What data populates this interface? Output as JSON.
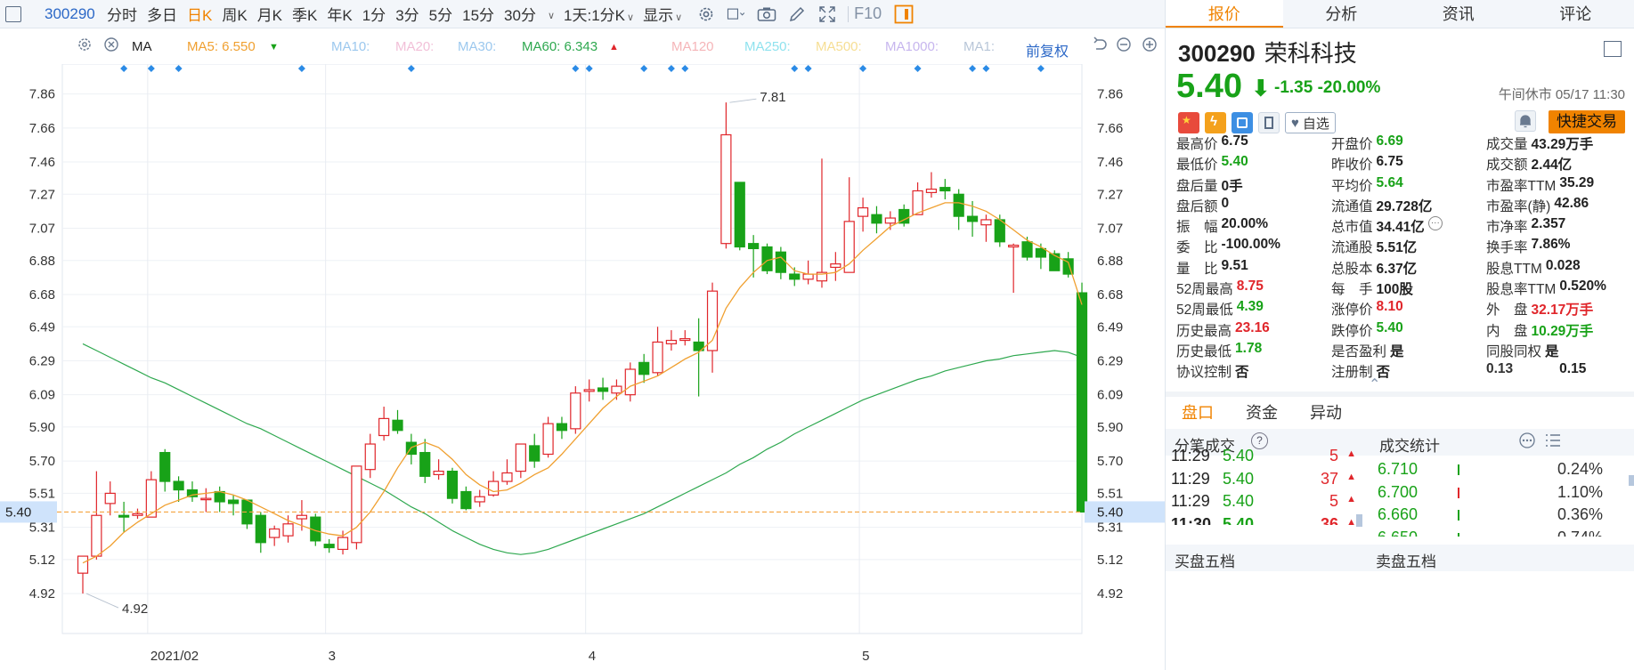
{
  "toolbar": {
    "code": "300290",
    "periods": [
      "分时",
      "多日",
      "日K",
      "周K",
      "月K",
      "季K",
      "年K",
      "1分",
      "3分",
      "5分",
      "15分",
      "30分"
    ],
    "active_period": "日K",
    "range_dropdown": "1天:1分K",
    "display_dropdown": "显示",
    "f10": "F10"
  },
  "ma_row": {
    "ma_label": "MA",
    "ma5": "MA5: 6.550",
    "ma10": "MA10:",
    "ma20": "MA20:",
    "ma30": "MA30:",
    "ma60": "MA60: 6.343",
    "ma120": "MA120",
    "ma250": "MA250:",
    "ma500": "MA500:",
    "ma1000": "MA1000:",
    "ma1": "MA1:",
    "adjust": "前复权"
  },
  "colors": {
    "up": "#e0262b",
    "down": "#18a218",
    "accent": "#f08300",
    "ma5": "#f0a030",
    "ma60": "#2ea84f"
  },
  "chart_data": {
    "type": "candlestick",
    "y_ticks": [
      "7.86",
      "7.66",
      "7.46",
      "7.27",
      "7.07",
      "6.88",
      "6.68",
      "6.49",
      "6.29",
      "6.09",
      "5.90",
      "5.70",
      "5.51",
      "5.31",
      "5.12",
      "4.92"
    ],
    "y_range": [
      4.8,
      7.9
    ],
    "x_labels": [
      "2021/02",
      "3",
      "4",
      "5"
    ],
    "current_price_tag": "5.40",
    "high_annotation": "7.81",
    "low_annotation": "4.92",
    "candles": [
      [
        5.04,
        5.14,
        4.92,
        5.14
      ],
      [
        5.14,
        5.38,
        5.12,
        5.64
      ],
      [
        5.45,
        5.51,
        5.38,
        5.58
      ],
      [
        5.38,
        5.37,
        5.28,
        5.46
      ],
      [
        5.38,
        5.39,
        5.36,
        5.42
      ],
      [
        5.37,
        5.59,
        5.37,
        5.64
      ],
      [
        5.75,
        5.58,
        5.52,
        5.77
      ],
      [
        5.58,
        5.53,
        5.46,
        5.61
      ],
      [
        5.53,
        5.49,
        5.46,
        5.58
      ],
      [
        5.48,
        5.48,
        5.4,
        5.54
      ],
      [
        5.52,
        5.46,
        5.4,
        5.55
      ],
      [
        5.47,
        5.45,
        5.38,
        5.5
      ],
      [
        5.47,
        5.33,
        5.3,
        5.47
      ],
      [
        5.38,
        5.22,
        5.16,
        5.4
      ],
      [
        5.25,
        5.3,
        5.2,
        5.32
      ],
      [
        5.26,
        5.33,
        5.22,
        5.38
      ],
      [
        5.36,
        5.38,
        5.29,
        5.47
      ],
      [
        5.37,
        5.23,
        5.2,
        5.39
      ],
      [
        5.21,
        5.19,
        5.16,
        5.24
      ],
      [
        5.18,
        5.25,
        5.15,
        5.29
      ],
      [
        5.22,
        5.67,
        5.18,
        5.67
      ],
      [
        5.65,
        5.8,
        5.6,
        5.86
      ],
      [
        5.85,
        5.95,
        5.82,
        6.02
      ],
      [
        5.94,
        5.88,
        5.86,
        6.0
      ],
      [
        5.81,
        5.74,
        5.68,
        5.86
      ],
      [
        5.75,
        5.61,
        5.57,
        5.83
      ],
      [
        5.62,
        5.64,
        5.59,
        5.71
      ],
      [
        5.64,
        5.48,
        5.45,
        5.66
      ],
      [
        5.52,
        5.42,
        5.41,
        5.55
      ],
      [
        5.46,
        5.49,
        5.43,
        5.53
      ],
      [
        5.5,
        5.58,
        5.49,
        5.64
      ],
      [
        5.58,
        5.63,
        5.56,
        5.71
      ],
      [
        5.64,
        5.8,
        5.6,
        5.8
      ],
      [
        5.79,
        5.7,
        5.66,
        5.86
      ],
      [
        5.74,
        5.92,
        5.72,
        5.96
      ],
      [
        5.92,
        5.88,
        5.83,
        5.96
      ],
      [
        5.89,
        6.1,
        5.86,
        6.14
      ],
      [
        6.11,
        6.12,
        6.05,
        6.18
      ],
      [
        6.13,
        6.11,
        6.06,
        6.19
      ],
      [
        6.1,
        6.14,
        6.06,
        6.18
      ],
      [
        6.09,
        6.24,
        6.05,
        6.28
      ],
      [
        6.28,
        6.21,
        6.16,
        6.33
      ],
      [
        6.22,
        6.4,
        6.2,
        6.49
      ],
      [
        6.39,
        6.41,
        6.35,
        6.47
      ],
      [
        6.41,
        6.42,
        6.38,
        6.47
      ],
      [
        6.4,
        6.35,
        6.08,
        6.54
      ],
      [
        6.35,
        6.7,
        6.22,
        6.75
      ],
      [
        6.98,
        7.62,
        6.95,
        7.81
      ],
      [
        7.34,
        6.96,
        6.94,
        7.34
      ],
      [
        6.98,
        6.95,
        6.78,
        7.03
      ],
      [
        6.96,
        6.82,
        6.8,
        6.98
      ],
      [
        6.93,
        6.81,
        6.77,
        6.96
      ],
      [
        6.8,
        6.77,
        6.73,
        6.84
      ],
      [
        6.77,
        6.8,
        6.74,
        6.88
      ],
      [
        6.76,
        6.81,
        6.72,
        7.48
      ],
      [
        6.84,
        6.86,
        6.76,
        6.93
      ],
      [
        6.81,
        7.11,
        6.81,
        7.37
      ],
      [
        7.14,
        7.19,
        7.05,
        7.25
      ],
      [
        7.15,
        7.1,
        7.04,
        7.2
      ],
      [
        7.1,
        7.13,
        7.06,
        7.17
      ],
      [
        7.18,
        7.1,
        7.08,
        7.21
      ],
      [
        7.15,
        7.29,
        7.15,
        7.34
      ],
      [
        7.28,
        7.3,
        7.25,
        7.4
      ],
      [
        7.31,
        7.29,
        7.24,
        7.36
      ],
      [
        7.27,
        7.14,
        7.06,
        7.3
      ],
      [
        7.14,
        7.11,
        7.02,
        7.23
      ],
      [
        7.09,
        7.12,
        6.99,
        7.15
      ],
      [
        7.12,
        6.99,
        6.96,
        7.15
      ],
      [
        6.96,
        6.97,
        6.69,
        6.98
      ],
      [
        6.99,
        6.9,
        6.88,
        7.02
      ],
      [
        6.95,
        6.9,
        6.83,
        6.98
      ],
      [
        6.92,
        6.82,
        6.82,
        6.94
      ],
      [
        6.89,
        6.8,
        6.78,
        6.93
      ],
      [
        6.69,
        5.4,
        5.4,
        6.75
      ]
    ],
    "ma5": [
      5.1,
      5.14,
      5.2,
      5.28,
      5.34,
      5.39,
      5.44,
      5.47,
      5.5,
      5.51,
      5.52,
      5.5,
      5.47,
      5.43,
      5.39,
      5.35,
      5.32,
      5.29,
      5.27,
      5.26,
      5.31,
      5.4,
      5.52,
      5.66,
      5.78,
      5.81,
      5.78,
      5.71,
      5.62,
      5.56,
      5.52,
      5.53,
      5.57,
      5.62,
      5.66,
      5.74,
      5.83,
      5.92,
      6.01,
      6.08,
      6.14,
      6.17,
      6.2,
      6.25,
      6.3,
      6.34,
      6.41,
      6.6,
      6.72,
      6.81,
      6.88,
      6.9,
      6.82,
      6.8,
      6.8,
      6.81,
      6.86,
      6.94,
      7.01,
      7.08,
      7.12,
      7.16,
      7.19,
      7.22,
      7.22,
      7.2,
      7.17,
      7.12,
      7.06,
      7.0,
      6.96,
      6.91,
      6.87,
      6.62
    ],
    "ma60": [
      6.39,
      6.35,
      6.31,
      6.27,
      6.23,
      6.19,
      6.16,
      6.12,
      6.08,
      6.04,
      6.0,
      5.96,
      5.92,
      5.89,
      5.85,
      5.81,
      5.77,
      5.73,
      5.69,
      5.65,
      5.61,
      5.57,
      5.53,
      5.48,
      5.43,
      5.39,
      5.34,
      5.29,
      5.25,
      5.21,
      5.18,
      5.16,
      5.15,
      5.16,
      5.18,
      5.21,
      5.24,
      5.27,
      5.3,
      5.33,
      5.36,
      5.39,
      5.43,
      5.47,
      5.51,
      5.55,
      5.59,
      5.63,
      5.68,
      5.72,
      5.77,
      5.81,
      5.86,
      5.9,
      5.94,
      5.98,
      6.02,
      6.06,
      6.09,
      6.12,
      6.15,
      6.18,
      6.2,
      6.23,
      6.25,
      6.27,
      6.29,
      6.3,
      6.32,
      6.33,
      6.34,
      6.35,
      6.34,
      6.31
    ],
    "event_marker_positions": [
      3,
      5,
      7,
      16,
      24,
      36,
      37,
      41,
      43,
      44,
      52,
      53,
      57,
      61,
      65,
      66,
      70
    ]
  },
  "quote": {
    "code": "300290",
    "name": "荣科科技",
    "price": "5.40",
    "arrow": "⬇",
    "change": "-1.35",
    "change_pct": "-20.00%",
    "status_time": "午间休市 05/17 11:30",
    "fav_label": "自选",
    "fast_trade": "快捷交易"
  },
  "stats": [
    [
      {
        "k": "最高价",
        "v": "6.75",
        "c": ""
      },
      {
        "k": "开盘价",
        "v": "6.69",
        "c": "green"
      },
      {
        "k": "成交量",
        "v": "43.29万手",
        "c": ""
      }
    ],
    [
      {
        "k": "最低价",
        "v": "5.40",
        "c": "green"
      },
      {
        "k": "昨收价",
        "v": "6.75",
        "c": ""
      },
      {
        "k": "成交额",
        "v": "2.44亿",
        "c": ""
      }
    ],
    [
      {
        "k": "盘后量",
        "v": "0手",
        "c": ""
      },
      {
        "k": "平均价",
        "v": "5.64",
        "c": "green"
      },
      {
        "k": "市盈率TTM",
        "v": "35.29",
        "c": ""
      }
    ],
    [
      {
        "k": "盘后额",
        "v": "0",
        "c": ""
      },
      {
        "k": "流通值",
        "v": "29.728亿",
        "c": ""
      },
      {
        "k": "市盈率(静)",
        "v": "42.86",
        "c": ""
      }
    ],
    [
      {
        "k": "振　幅",
        "v": "20.00%",
        "c": ""
      },
      {
        "k": "总市值",
        "v": "34.41亿",
        "c": ""
      },
      {
        "k": "市净率",
        "v": "2.357",
        "c": ""
      }
    ],
    [
      {
        "k": "委　比",
        "v": "-100.00%",
        "c": ""
      },
      {
        "k": "流通股",
        "v": "5.51亿",
        "c": ""
      },
      {
        "k": "换手率",
        "v": "7.86%",
        "c": ""
      }
    ],
    [
      {
        "k": "量　比",
        "v": "9.51",
        "c": ""
      },
      {
        "k": "总股本",
        "v": "6.37亿",
        "c": ""
      },
      {
        "k": "股息TTM",
        "v": "0.028",
        "c": ""
      }
    ],
    [
      {
        "k": "52周最高",
        "v": "8.75",
        "c": "red"
      },
      {
        "k": "每　手",
        "v": "100股",
        "c": ""
      },
      {
        "k": "股息率TTM",
        "v": "0.520%",
        "c": ""
      }
    ],
    [
      {
        "k": "52周最低",
        "v": "4.39",
        "c": "green"
      },
      {
        "k": "涨停价",
        "v": "8.10",
        "c": "red"
      },
      {
        "k": "外　盘",
        "v": "32.17万手",
        "c": "red"
      }
    ],
    [
      {
        "k": "历史最高",
        "v": "23.16",
        "c": "red"
      },
      {
        "k": "跌停价",
        "v": "5.40",
        "c": "green"
      },
      {
        "k": "内　盘",
        "v": "10.29万手",
        "c": "green"
      }
    ],
    [
      {
        "k": "历史最低",
        "v": "1.78",
        "c": "green"
      },
      {
        "k": "是否盈利",
        "v": "是",
        "c": ""
      },
      {
        "k": "同股同权",
        "v": "是",
        "c": ""
      }
    ],
    [
      {
        "k": "协议控制",
        "v": "否",
        "c": ""
      },
      {
        "k": "注册制",
        "v": "否",
        "c": ""
      },
      {
        "k": "0.13",
        "v": "0.15",
        "c": ""
      }
    ]
  ],
  "right_tabs": [
    "报价",
    "分析",
    "资讯",
    "评论"
  ],
  "sub_tabs": [
    "盘口",
    "资金",
    "异动"
  ],
  "trades_header": {
    "left": "分笔成交",
    "right": "成交统计"
  },
  "trades": [
    {
      "time": "11:29",
      "price": "5.40",
      "vol": "5"
    },
    {
      "time": "11:29",
      "price": "5.40",
      "vol": "37"
    },
    {
      "time": "11:29",
      "price": "5.40",
      "vol": "5"
    },
    {
      "time": "11:30",
      "price": "5.40",
      "vol": "36"
    }
  ],
  "trade_stats": [
    {
      "price": "6.710",
      "pct": "0.24%",
      "bar": "green"
    },
    {
      "price": "6.700",
      "pct": "1.10%",
      "bar": "red"
    },
    {
      "price": "6.660",
      "pct": "0.36%",
      "bar": "green"
    },
    {
      "price": "6.650",
      "pct": "0.74%",
      "bar": "green"
    }
  ],
  "order_header": {
    "buy": "买盘五档",
    "sell": "卖盘五档"
  }
}
